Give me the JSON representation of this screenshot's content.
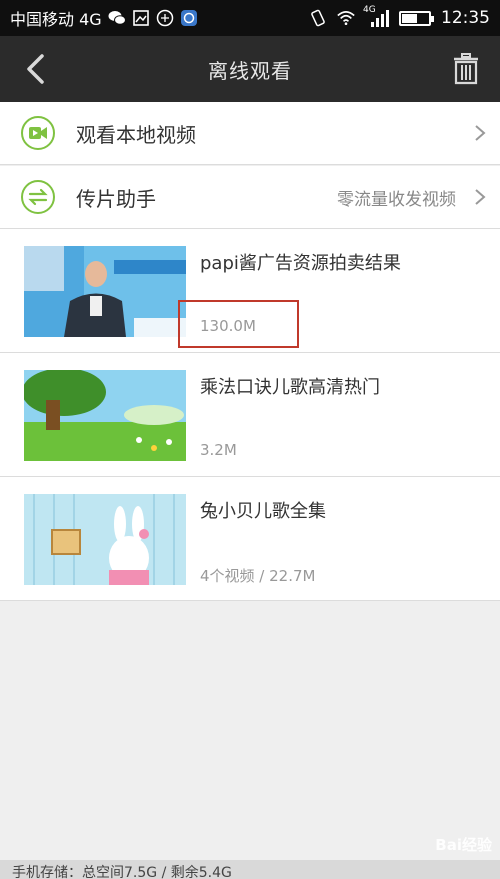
{
  "status_bar": {
    "carrier": "中国移动 4G",
    "time": "12:35",
    "network": "4G",
    "battery_level": 0.55
  },
  "header": {
    "title": "离线观看"
  },
  "menu": {
    "local_video": {
      "label": "观看本地视频",
      "icon": "video-camera-icon"
    },
    "transfer": {
      "label": "传片助手",
      "sub": "零流量收发视频",
      "icon": "swap-arrows-icon"
    }
  },
  "videos": [
    {
      "title": "papi酱广告资源拍卖结果",
      "meta": "130.0M"
    },
    {
      "title": "乘法口诀儿歌高清热门",
      "meta": "3.2M"
    },
    {
      "title": "兔小贝儿歌全集",
      "meta": "4个视频 / 22.7M"
    }
  ],
  "footer": {
    "storage": "手机存储：总空间7.5G / 剩余5.4G"
  },
  "watermark": "Bai经验",
  "colors": {
    "accent": "#7fc241",
    "titlebar": "#2b2b2b",
    "highlight": "#c0392b"
  }
}
